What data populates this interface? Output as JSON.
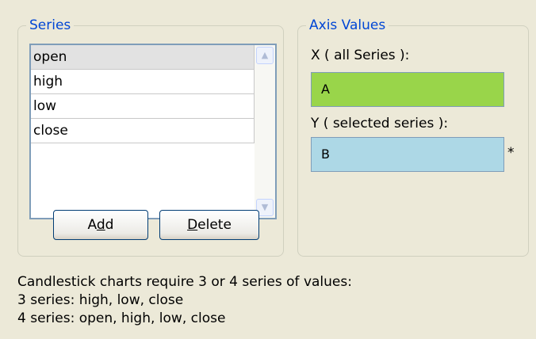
{
  "series_group": {
    "title": "Series",
    "items": [
      "open",
      "high",
      "low",
      "close"
    ],
    "selected": "open",
    "add_label": "Add",
    "add_mnemonic": "d",
    "delete_label": "Delete",
    "delete_mnemonic": "D"
  },
  "axis_group": {
    "title": "Axis Values",
    "x_label": "X ( all Series ):",
    "x_value": "A",
    "y_label": "Y ( selected series ):",
    "y_value": "B",
    "y_marker": "*"
  },
  "footer": {
    "line1": "Candlestick charts require 3 or 4 series of values:",
    "line2": "3 series: high, low, close",
    "line3": "4 series: open, high, low, close"
  },
  "colors": {
    "x_field": "#99d54a",
    "y_field": "#add8e6",
    "legend_text": "#0046d5",
    "background": "#ece9d8"
  },
  "icons": {
    "scroll_up": "chevron-up-icon",
    "scroll_down": "chevron-down-icon"
  }
}
